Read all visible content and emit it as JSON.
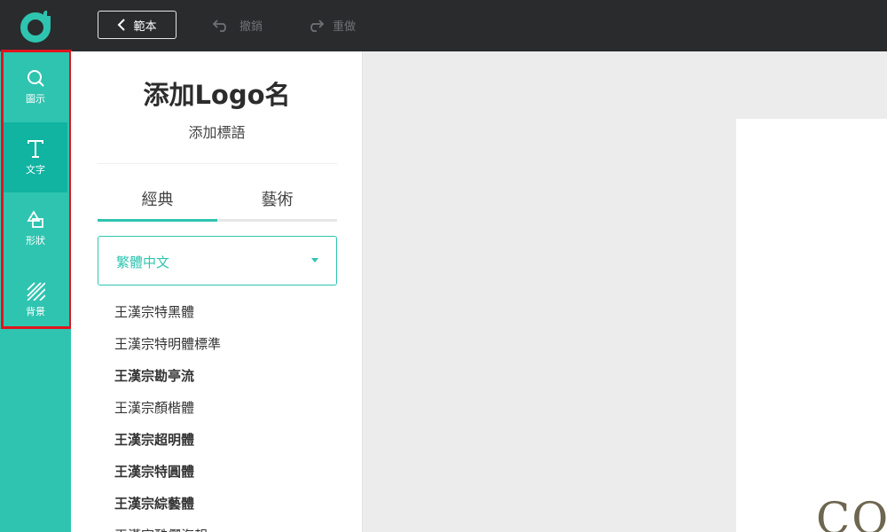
{
  "topbar": {
    "back_label": "範本",
    "undo_label": "撤銷",
    "redo_label": "重做"
  },
  "rail": {
    "items": [
      {
        "label": "圖示",
        "icon": "search-icon"
      },
      {
        "label": "文字",
        "icon": "text-icon"
      },
      {
        "label": "形狀",
        "icon": "shapes-icon"
      },
      {
        "label": "背景",
        "icon": "background-icon"
      }
    ],
    "active_index": 1
  },
  "panel": {
    "logo_name": "添加Logo名",
    "slogan": "添加標語",
    "tabs": [
      "經典",
      "藝術"
    ],
    "active_tab": 0,
    "language_select": {
      "value": "繁體中文"
    },
    "fonts": [
      "王漢宗特黑體",
      "王漢宗特明體標準",
      "王漢宗勘亭流",
      "王漢宗顏楷體",
      "王漢宗超明體",
      "王漢宗特圓體",
      "王漢宗綜藝體",
      "王漢宗酷儷海報"
    ]
  },
  "canvas": {
    "artboard_text": "CO"
  },
  "colors": {
    "accent": "#2ec4b0",
    "rail_active": "#11b3a1",
    "topbar": "#2a2b2d",
    "highlight": "#e3131c"
  }
}
